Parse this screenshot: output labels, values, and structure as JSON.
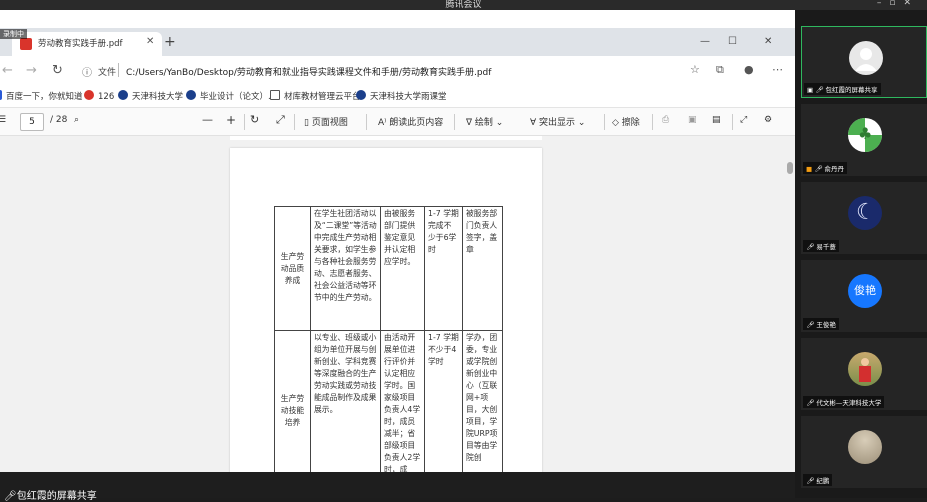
{
  "meeting": {
    "title": "腾讯会议",
    "share_status": "包红霞的屏幕共享"
  },
  "browser": {
    "tab_title": "劳动教育实践手册.pdf",
    "rec_badge": "录制中",
    "url_prefix": "文件",
    "url": "C:/Users/YanBo/Desktop/劳动教育和就业指导实践课程文件和手册/劳动教育实践手册.pdf",
    "bookmarks": [
      {
        "label": "百度一下，你就知道",
        "color": "#2a5bd7"
      },
      {
        "label": "126",
        "color": "#d9342b"
      },
      {
        "label": "天津科技大学",
        "color": "#1b3f8b"
      },
      {
        "label": "毕业设计（论文）...",
        "color": "#1b3f8b"
      },
      {
        "label": "材库教材管理云平台",
        "color": "#555555"
      },
      {
        "label": "天津科技大学雨课堂",
        "color": "#1b3f8b"
      }
    ]
  },
  "pdf_toolbar": {
    "current_page": "5",
    "total_pages": "/ 28",
    "page_view": "页面视图",
    "read_aloud": "朗读此页内容",
    "draw": "绘制",
    "highlight": "突出显示",
    "erase": "擦除"
  },
  "document": {
    "rows": [
      {
        "category": "生产劳动品质养成",
        "content": "在学生社团活动以及“二课堂”等活动中完成生产劳动相关要求，如学生参与各种社会服务劳动、志愿者服务、社会公益活动等环节中的生产劳动。",
        "certify": "由被服务部门提供鉴定意见并认定相应学时。",
        "hours": "1-7 学期完成不少于6学时",
        "signer": "被服务部门负责人签字，盖章"
      },
      {
        "category": "生产劳动技能培养",
        "content": "以专业、班级或小组为单位开展与创新创业、学科竞赛等深度融合的生产劳动实践或劳动技能成品制作及成果展示。",
        "certify": "由活动开展单位进行评价并认定相应学时。国家级项目负责人4学时，成员减半；省部级项目负责人2学时，成",
        "hours": "1-7 学期不少于4学时",
        "signer": "学办，团委，专业或学院创新创业中心（互联网+项目，大创项目，学院URP项目等由学院创"
      }
    ]
  },
  "participants": [
    {
      "name": "包红霞的屏幕共享",
      "avatar": "#e8e8e8",
      "glyph": ""
    },
    {
      "name": "俞丹丹",
      "avatar": "#4caf50",
      "glyph": "♣"
    },
    {
      "name": "易千薏",
      "avatar": "#1a2a6b",
      "glyph": "☾"
    },
    {
      "name": "王俊艳",
      "avatar": "#1677ff",
      "glyph": "俊艳"
    },
    {
      "name": "代文彬—天津科技大学",
      "avatar": "#8a9a5b",
      "glyph": ""
    },
    {
      "name": "纪鹏",
      "avatar": "#b8a98a",
      "glyph": ""
    }
  ]
}
